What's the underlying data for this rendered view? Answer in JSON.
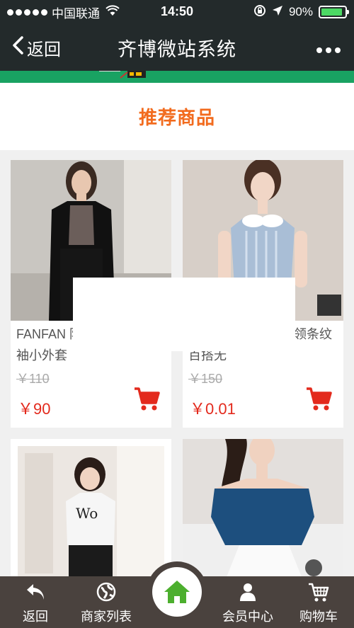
{
  "status_bar": {
    "carrier": "中国联通",
    "time": "14:50",
    "battery": "90%",
    "battery_level": 0.9,
    "wifi_icon": "wifi-icon",
    "location_icon": "location-arrow-icon",
    "lock_icon": "rotation-lock-icon"
  },
  "nav": {
    "back_label": "返回",
    "title": "齐博微站系统",
    "more_icon": "more-dots-icon"
  },
  "section": {
    "title": "推荐商品"
  },
  "products": [
    {
      "name": "FANFAN 防晒衣纯色蝙蝠袖小外套",
      "old_price": "￥110",
      "price": "￥90",
      "image": "woman-black-cardigan-photo"
    },
    {
      "name": "女装韩 版拼色娃娃领条纹百搭无",
      "old_price": "￥150",
      "price": "￥0.01",
      "image": "woman-striped-sleeveless-top-photo"
    },
    {
      "name": "",
      "old_price": "",
      "price": "",
      "image": "woman-white-printed-tee-photo"
    },
    {
      "name": "",
      "old_price": "",
      "price": "",
      "image": "woman-blue-off-shoulder-top-photo"
    }
  ],
  "tabbar": {
    "items": [
      {
        "label": "返回",
        "icon": "back-arrow-icon"
      },
      {
        "label": "商家列表",
        "icon": "globe-icon"
      },
      {
        "label": "",
        "icon": "home-icon"
      },
      {
        "label": "会员中心",
        "icon": "user-icon"
      },
      {
        "label": "购物车",
        "icon": "cart-icon"
      }
    ]
  },
  "colors": {
    "header_bg": "#232a2b",
    "accent_green": "#19a262",
    "title_orange": "#f26b1e",
    "price_red": "#e32a1d",
    "tabbar_bg": "#4a423e",
    "home_green": "#4caf2e"
  }
}
